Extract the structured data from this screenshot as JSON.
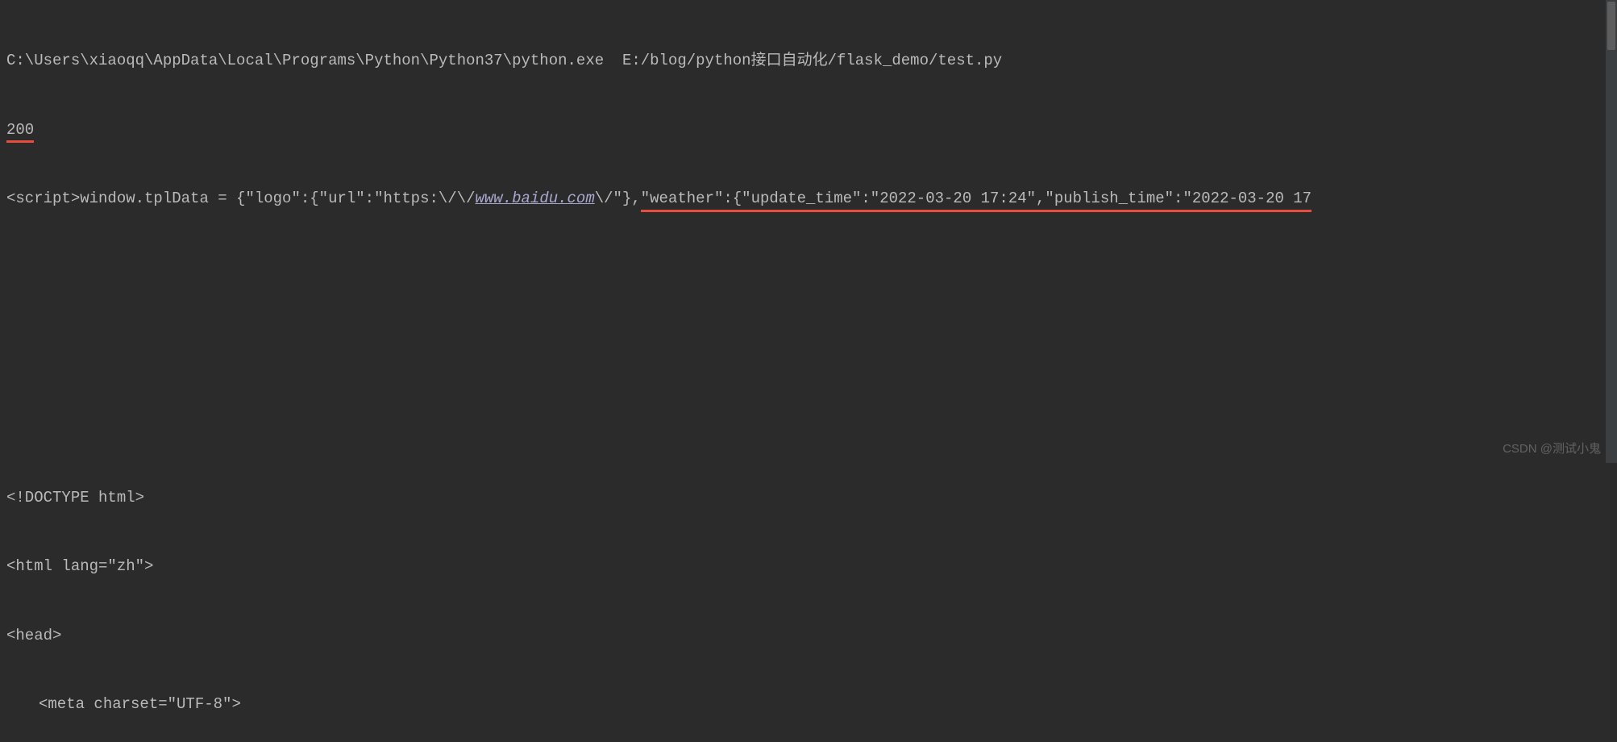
{
  "console": {
    "line1": {
      "exe_path": "C:\\Users\\xiaoqq\\AppData\\Local\\Programs\\Python\\Python37\\python.exe",
      "script_path": "E:/blog/python接口自动化/flask_demo/test.py"
    },
    "line2": {
      "status_code": "200"
    },
    "line3": {
      "prefix": "<script>window.tplData = {\"logo\":{\"url\":\"https:\\/\\/",
      "link_text": "www.baidu.com",
      "after_link": "\\/\"},",
      "underlined_part": "\"weather\":{\"update_time\":\"2022-03-20 17:24\",\"publish_time\":\"2022-03-20 17"
    },
    "html_output": {
      "doctype": "<!DOCTYPE html>",
      "html_tag": "<html lang=\"zh\">",
      "head_tag": "<head>",
      "meta_tag": "<meta charset=\"UTF-8\">"
    }
  },
  "watermark": "CSDN @测试小鬼"
}
